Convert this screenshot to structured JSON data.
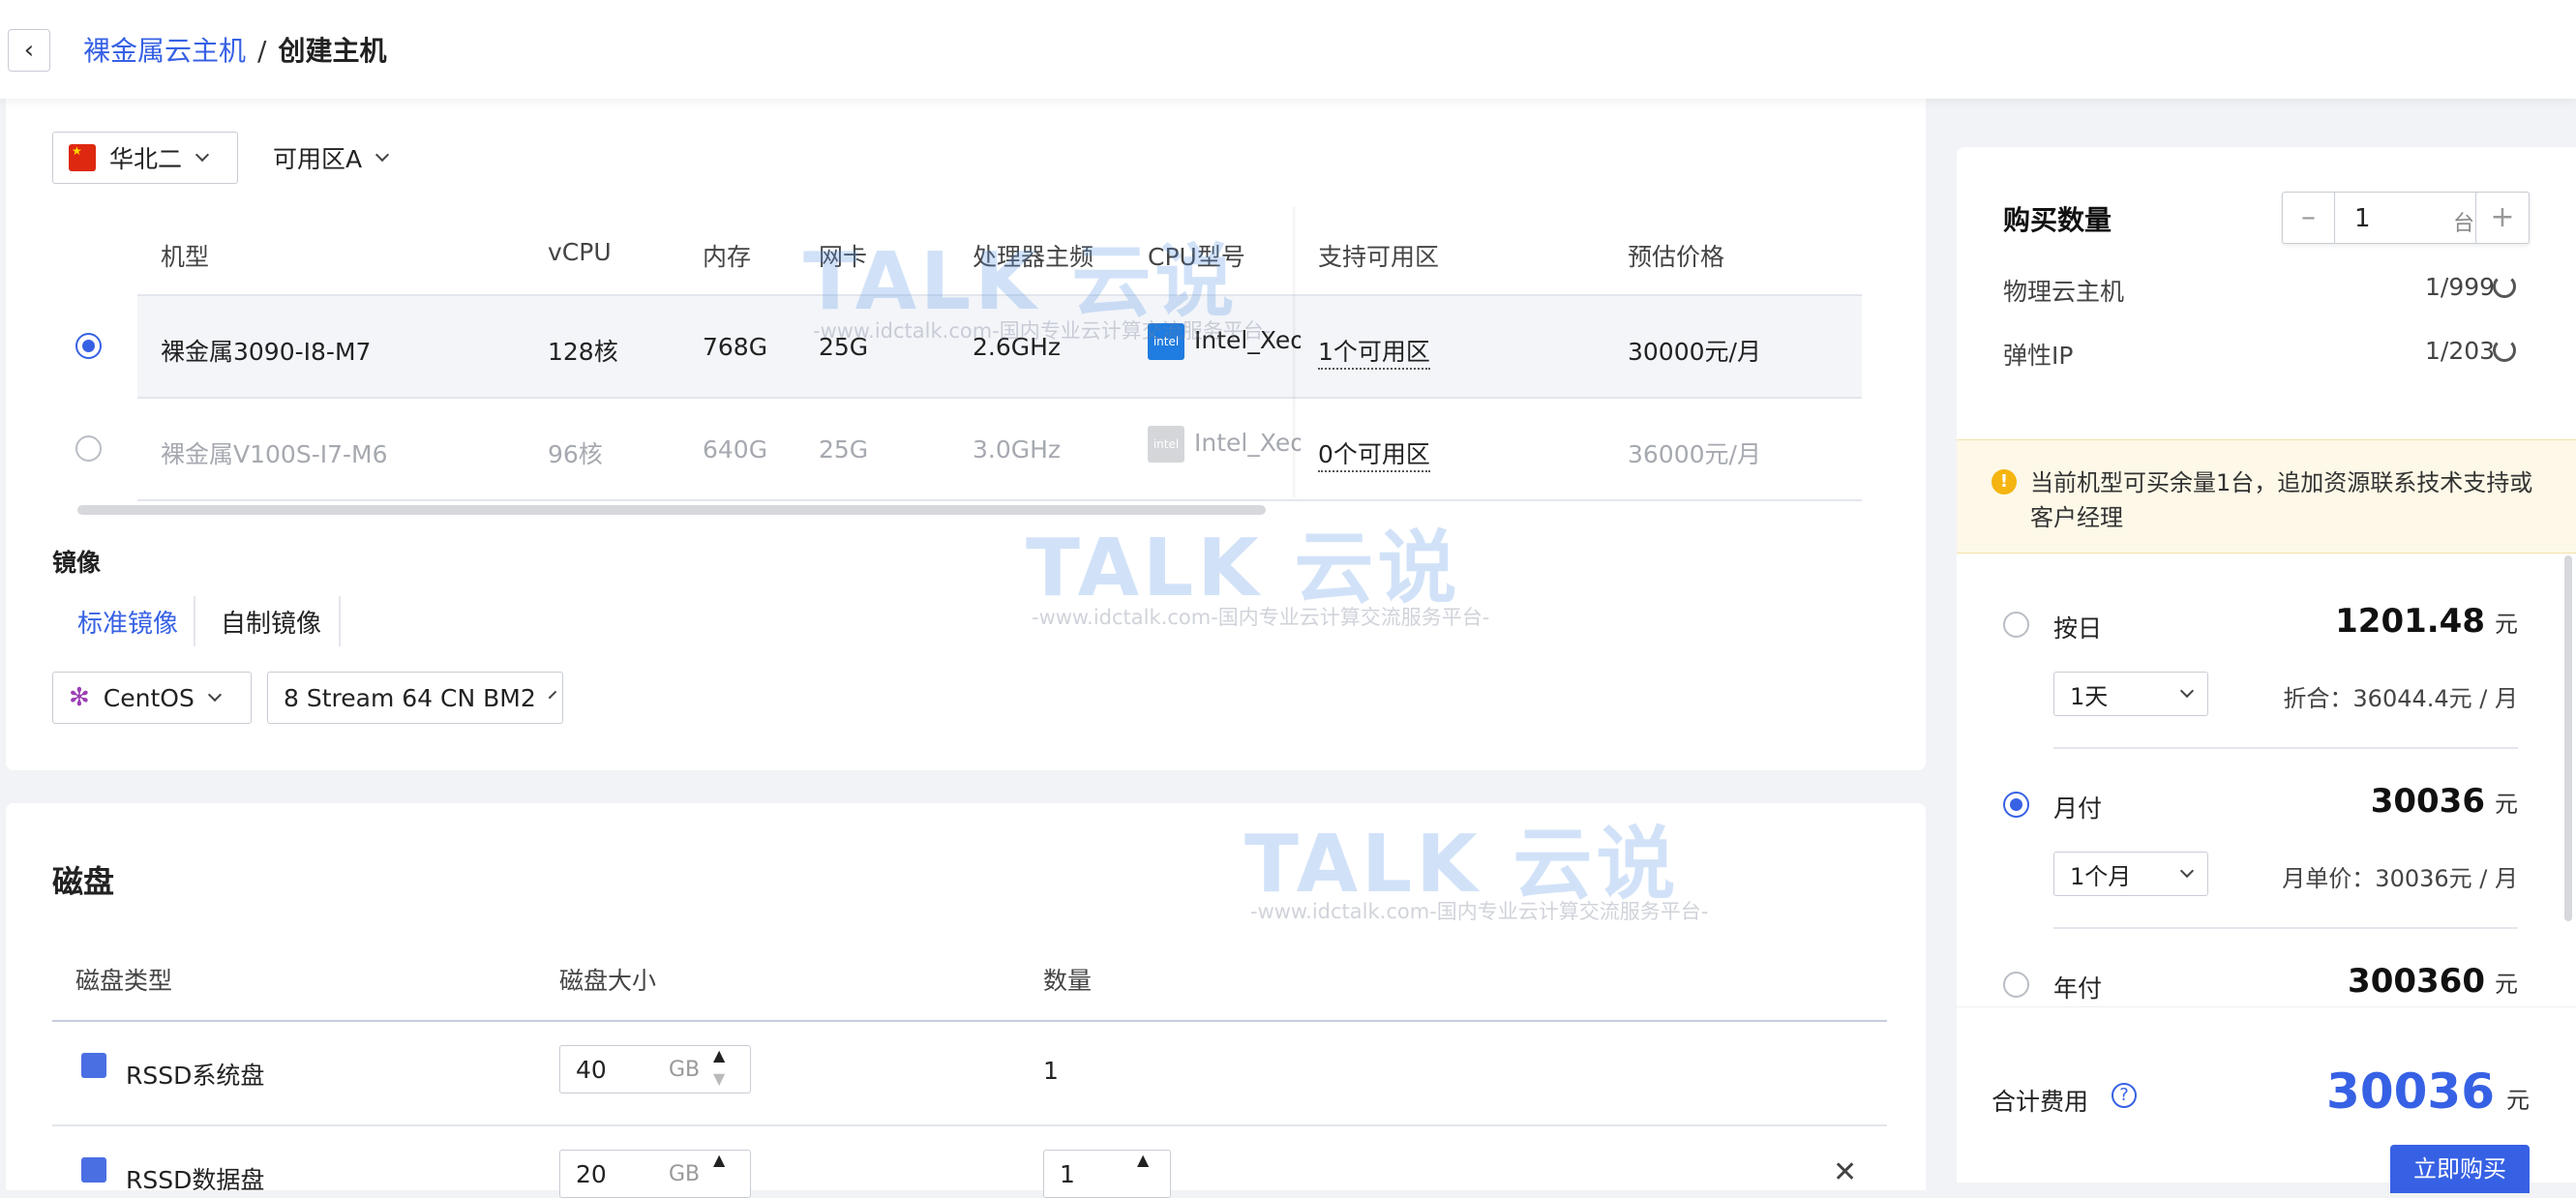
{
  "header": {
    "breadcrumb_parent": "裸金属云主机",
    "breadcrumb_sep": "/",
    "breadcrumb_current": "创建主机"
  },
  "region": {
    "value": "华北二",
    "zone": "可用区A"
  },
  "machine_table": {
    "columns": [
      "机型",
      "vCPU",
      "内存",
      "网卡",
      "处理器主频",
      "CPU型号",
      "支持可用区",
      "预估价格"
    ],
    "rows": [
      {
        "model": "裸金属3090-I8-M7",
        "vcpu": "128核",
        "mem": "768G",
        "nic": "25G",
        "freq": "2.6GHz",
        "cpu": "Intel_Xeo",
        "zones": "1个可用区",
        "price": "30000元/月",
        "selected": true
      },
      {
        "model": "裸金属V100S-I7-M6",
        "vcpu": "96核",
        "mem": "640G",
        "nic": "25G",
        "freq": "3.0GHz",
        "cpu": "Intel_Xeo",
        "zones": "0个可用区",
        "price": "36000元/月",
        "selected": false
      }
    ]
  },
  "image": {
    "title": "镜像",
    "tabs": [
      "标准镜像",
      "自制镜像"
    ],
    "os": "CentOS",
    "version": "8 Stream 64 CN BM2"
  },
  "disk": {
    "title": "磁盘",
    "columns": [
      "磁盘类型",
      "磁盘大小",
      "数量"
    ],
    "rows": [
      {
        "type": "RSSD系统盘",
        "size": "40",
        "unit": "GB",
        "count": "1"
      },
      {
        "type": "RSSD数据盘",
        "size": "20",
        "unit": "GB",
        "count": "1"
      }
    ]
  },
  "purchase": {
    "title": "购买数量",
    "qty": "1",
    "qty_unit": "台",
    "physical_label": "物理云主机",
    "physical_val": "1/999",
    "eip_label": "弹性IP",
    "eip_val": "1/203",
    "warning": "当前机型可买余量1台，追加资源联系技术支持或客户经理"
  },
  "billing": [
    {
      "label": "按日",
      "price": "1201.48",
      "unit": "元",
      "period": "1天",
      "note": "折合：36044.4元 / 月",
      "selected": false
    },
    {
      "label": "月付",
      "price": "30036",
      "unit": "元",
      "period": "1个月",
      "note": "月单价：30036元 / 月",
      "selected": true
    },
    {
      "label": "年付",
      "price": "300360",
      "unit": "元",
      "selected": false
    }
  ],
  "total": {
    "label": "合计费用",
    "value": "30036",
    "unit": "元",
    "buy_label": "立即购买"
  },
  "watermark": {
    "logo": "TALK 云说",
    "url": "-www.idctalk.com-国内专业云计算交流服务平台-"
  },
  "colors": {
    "accent": "#3761e4",
    "warning_bg": "#fdf8e7",
    "warning_icon": "#f5b40f"
  }
}
